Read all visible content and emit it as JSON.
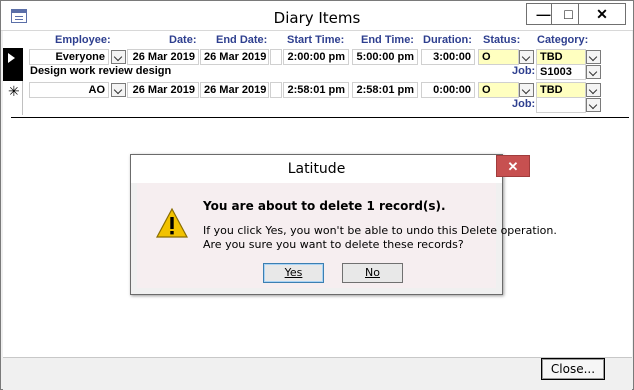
{
  "window": {
    "title": "Diary Items",
    "minimize": "—",
    "maximize": "□",
    "close": "✕"
  },
  "headers": {
    "employee": "Employee:",
    "date": "Date:",
    "end_date": "End Date:",
    "start_time": "Start Time:",
    "end_time": "End Time:",
    "duration": "Duration:",
    "status": "Status:",
    "category": "Category:"
  },
  "records": [
    {
      "employee": "Everyone",
      "date": "26 Mar 2019",
      "end_date": "26 Mar 2019",
      "start_time": "2:00:00 pm",
      "end_time": "5:00:00 pm",
      "duration": "3:00:00",
      "status": "O",
      "category": "TBD",
      "job_label": "Job:",
      "job": "S1003",
      "description": "Design work review design"
    },
    {
      "employee": "AO",
      "date": "26 Mar 2019",
      "end_date": "26 Mar 2019",
      "start_time": "2:58:01 pm",
      "end_time": "2:58:01 pm",
      "duration": "0:00:00",
      "status": "O",
      "category": "TBD",
      "job_label": "Job:",
      "job": "",
      "new_row_marker": "✳"
    }
  ],
  "footer": {
    "close_label": "Close..."
  },
  "dialog": {
    "title": "Latitude",
    "close": "✕",
    "message": "You are about to delete 1 record(s).",
    "detail_line1": "If you click Yes, you won't be able to undo this Delete operation.",
    "detail_line2": "Are you sure you want to delete these records?",
    "yes_label": "Yes",
    "no_label": "No",
    "icon": "warning-icon"
  }
}
